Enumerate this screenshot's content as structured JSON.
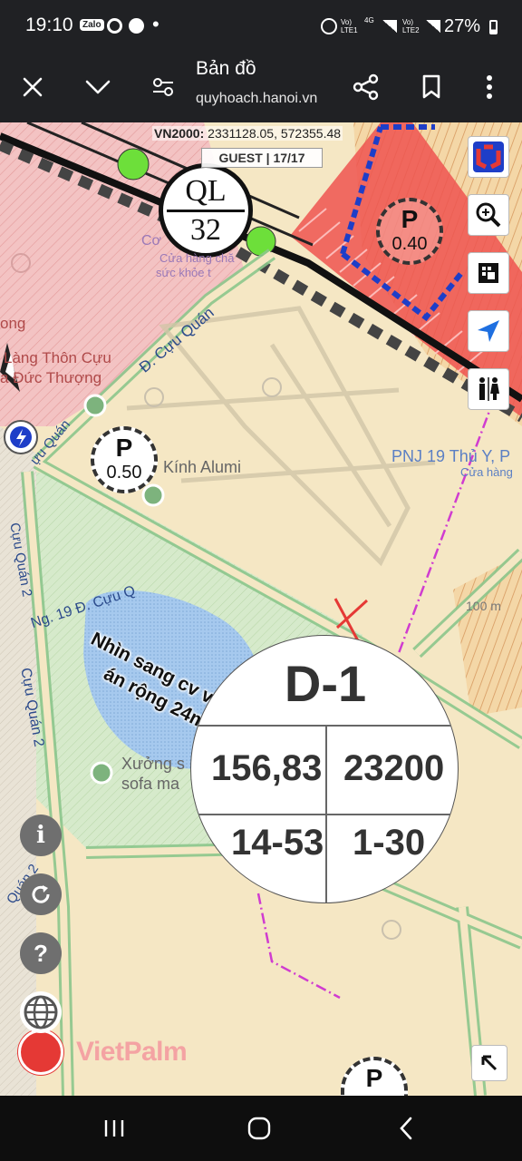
{
  "status_bar": {
    "time": "19:10",
    "apps": [
      "Zalo"
    ],
    "sim1": "Vo) LTE1",
    "net": "4G",
    "sim2": "Vo) LTE2",
    "battery": "27%"
  },
  "header": {
    "title": "Bản đồ",
    "url": "quyhoach.hanoi.vn",
    "close_icon": "close-icon",
    "expand_icon": "chevron-down-icon",
    "settings_icon": "sliders-icon",
    "share_icon": "share-icon",
    "bookmark_icon": "bookmark-icon",
    "menu_icon": "more-vert-icon"
  },
  "map": {
    "coordinates_label": "VN2000:",
    "coordinates_value": "2331128.05, 572355.48",
    "guest_label": "GUEST | 17/17",
    "highway_top": "QL",
    "highway_bottom": "32",
    "parking_label": "P",
    "parking_values": [
      "0.40",
      "0.50"
    ],
    "place_labels": {
      "cuu_quan_diag": "Đ. Cựu Quán",
      "thon_cuu": "Làng Thôn Cựu",
      "duc_thuong": "a Đức Thượng",
      "ong": "ong",
      "kinh_alumi": "Kính Alumi",
      "pnj": "PNJ 19 Thủ Y, P",
      "cua_hang": "Cửa hàng",
      "ng19": "Ng. 19 Đ. Cựu Q",
      "cuu_quan2_v": "Cựu Quán 2",
      "cuu_quan2_v2": "Cựu Quán 2",
      "cuu_quan2_small": "Cựu Quán 2",
      "quan2": "Quán 2",
      "cuu_quan_small": "ựu Quán",
      "xuong_sofa_1": "Xưởng s",
      "xuong_sofa_2": "sofa ma",
      "distance": "100 m",
      "faded1": "Cơ",
      "faded2": "Cửa hàng chă",
      "faded3": "sức khỏe t"
    },
    "annotation_line1": "Nhìn sang cv và đg dự",
    "annotation_line2": "án rộng 24m",
    "annotation_mark": "X",
    "parcel": {
      "id": "D-1",
      "area": "156,83",
      "code": "23200",
      "height": "14-53",
      "ratio": "1-30"
    },
    "bottom_parking": "P",
    "brand": "VietPalm",
    "right_tools": [
      "vietpalm-logo-icon",
      "zoom-search-icon",
      "layers-icon",
      "locate-arrow-icon",
      "toilet-icon"
    ],
    "left_tools": [
      "info-icon",
      "refresh-icon",
      "help-icon",
      "globe-icon"
    ],
    "colors": {
      "residential": "#f5e7c4",
      "mixed_use": "#f2b8b8",
      "green_space": "#cfe6c2",
      "water": "#9fc3e8",
      "road_outline": "#8cc68c",
      "red_hatch": "#e53935",
      "blue_border": "#1e3ec8",
      "brand_red": "#e53935"
    }
  },
  "nav": {
    "recent_icon": "recent-apps-icon",
    "home_icon": "home-icon",
    "back_icon": "back-icon"
  }
}
